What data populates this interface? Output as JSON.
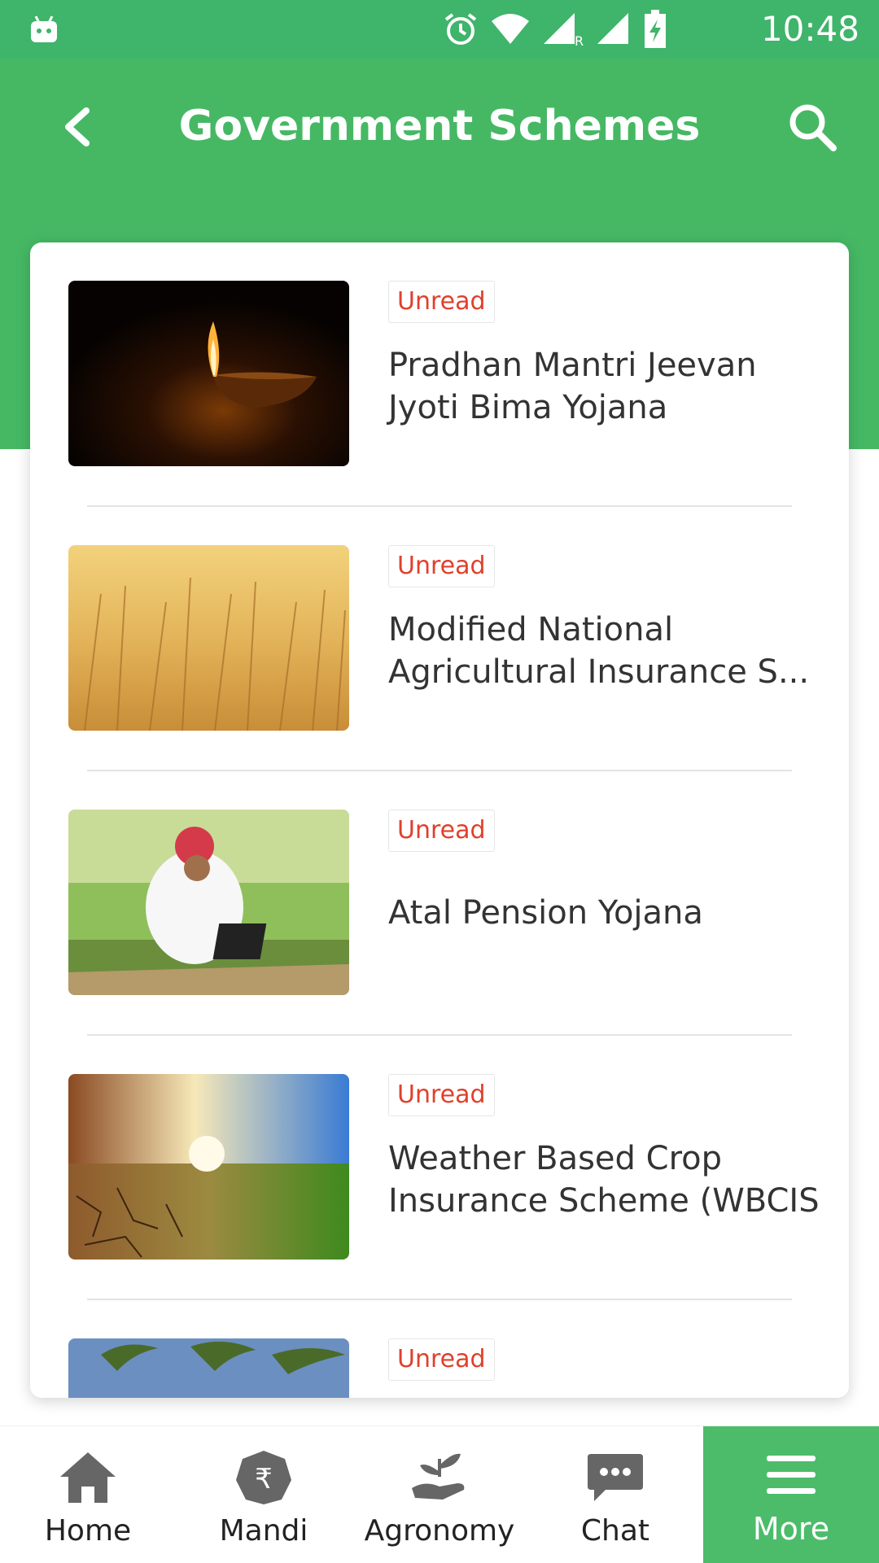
{
  "status_bar": {
    "time": "10:48"
  },
  "app_bar": {
    "title": "Government Schemes"
  },
  "schemes": [
    {
      "badge": "Unread",
      "title": "Pradhan Mantri Jeevan Jyoti Bima Yojana"
    },
    {
      "badge": "Unread",
      "title": "Modified National Agricultural Insurance S..."
    },
    {
      "badge": "Unread",
      "title": "Atal Pension Yojana"
    },
    {
      "badge": "Unread",
      "title": "Weather Based Crop Insurance Scheme (WBCIS"
    },
    {
      "badge": "Unread",
      "title": ""
    }
  ],
  "bottom_nav": [
    {
      "label": "Home",
      "icon": "home-icon"
    },
    {
      "label": "Mandi",
      "icon": "rupee-icon"
    },
    {
      "label": "Agronomy",
      "icon": "plant-hand-icon"
    },
    {
      "label": "Chat",
      "icon": "chat-icon"
    },
    {
      "label": "More",
      "icon": "menu-icon",
      "active": true
    }
  ],
  "colors": {
    "primary_green": "#46b864",
    "status_green": "#3fb46b",
    "unread_red": "#e0402c",
    "nav_icon_gray": "#666666"
  }
}
